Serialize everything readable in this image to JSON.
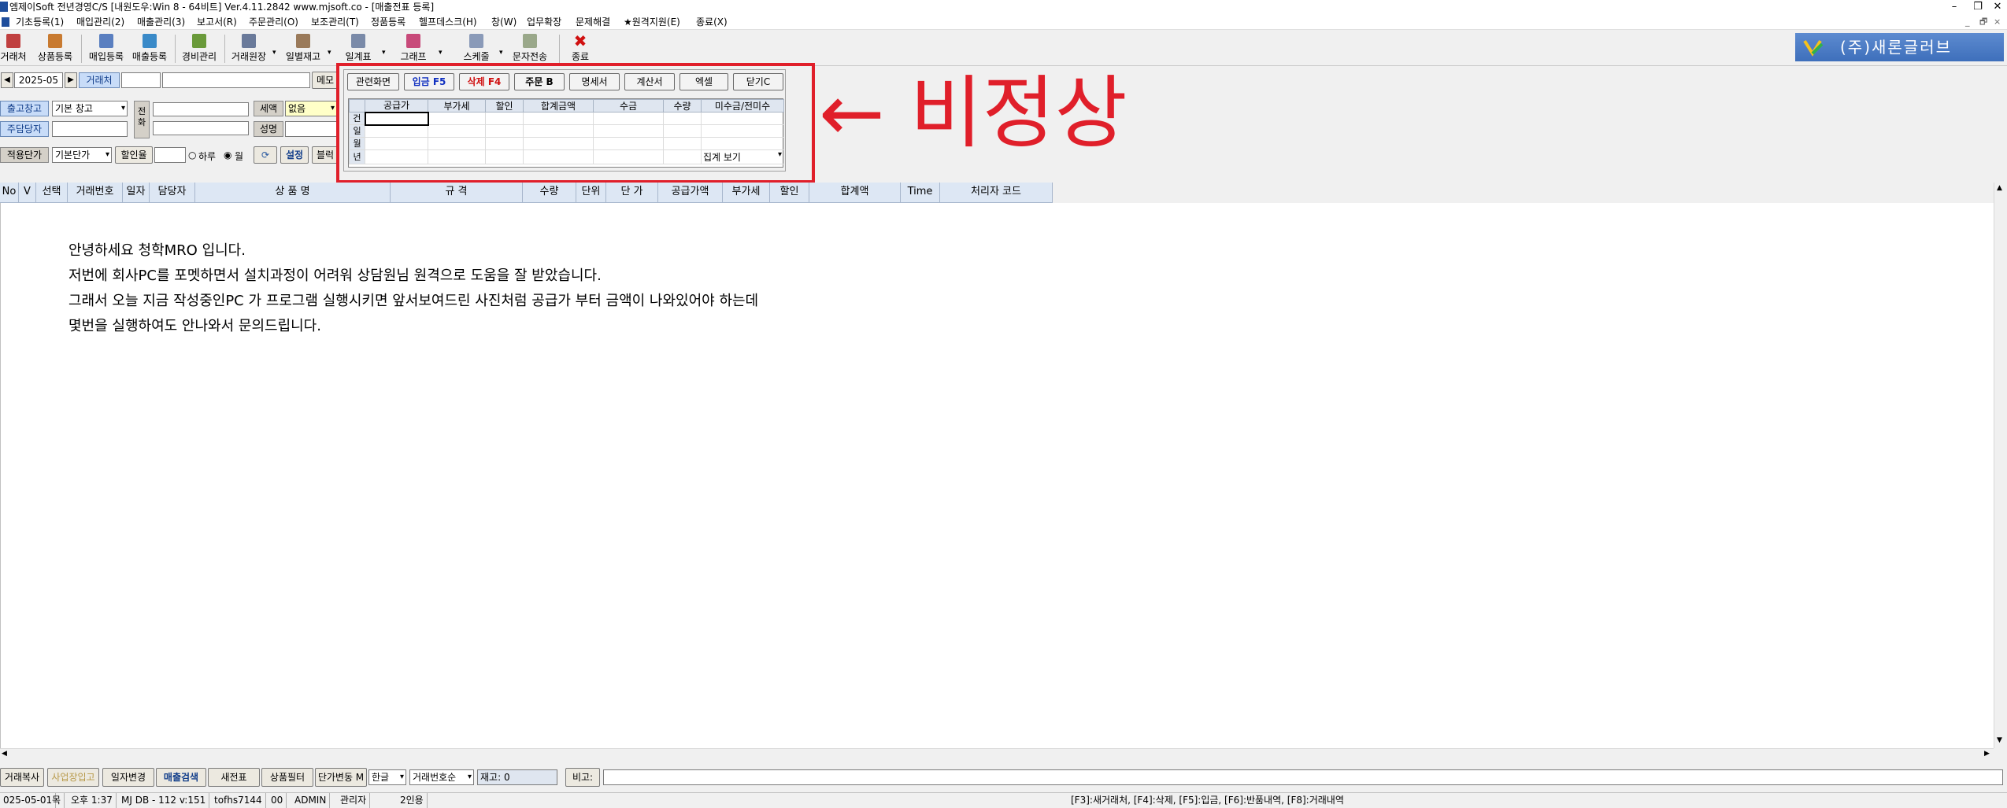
{
  "window": {
    "title": "엠제이Soft 전년경영C/S [내원도우:Win 8 - 64비트] Ver.4.11.2842        www.mjsoft.co - [매출전표 등록]",
    "min": "–",
    "restore": "❐",
    "close": "✕"
  },
  "menu": {
    "items": [
      "기초등록(1)",
      "매입관리(2)",
      "매출관리(3)",
      "보고서(R)",
      "주문관리(O)",
      "보조관리(T)",
      "정품등록",
      "헬프데스크(H)",
      "창(W)",
      "업무확장",
      "문제해결",
      "★원격지원(E)",
      "종료(X)"
    ],
    "sys": [
      "_",
      "🗗",
      "×"
    ]
  },
  "toolbar": {
    "buttons": [
      "거래처",
      "상품등록",
      "매입등록",
      "매출등록",
      "경비관리",
      "거래원장",
      "일별재고",
      "일계표",
      "그래프",
      "스케줄",
      "문자전송",
      "종료"
    ],
    "brand": "(주)새론글러브"
  },
  "form": {
    "date": "2025-05",
    "client_label": "거래처",
    "memo_label": "메모",
    "warehouse_label": "출고창고",
    "warehouse_value": "기본 창고",
    "staff_label": "주담당자",
    "phone_label": "전화",
    "tax_label": "세액",
    "tax_value": "없음",
    "name_label": "성명",
    "price_label": "적용단가",
    "price_value": "기본단가",
    "discount_label": "할인율",
    "radio_day": "하루",
    "radio_month": "월",
    "settings_label": "설정",
    "block_label": "블럭"
  },
  "popup": {
    "buttons": [
      "관련화면",
      "입금 F5",
      "삭제 F4",
      "주문 B",
      "명세서",
      "계산서",
      "엑셀",
      "닫기C"
    ],
    "columns": [
      "공급가",
      "부가세",
      "할인",
      "합계금액",
      "수금",
      "수량",
      "미수금/전미수"
    ],
    "row_labels": [
      "건",
      "일",
      "월",
      "년"
    ],
    "summary_select": "집계 보기"
  },
  "annotation": "← 비정상",
  "grid": {
    "columns": [
      "No",
      "V",
      "선택",
      "거래번호",
      "일자",
      "담당자",
      "상 품 명",
      "규 격",
      "수량",
      "단위",
      "단 가",
      "공급가액",
      "부가세",
      "할인",
      "합계액",
      "Time",
      "처리자 코드"
    ]
  },
  "message": [
    "안녕하세요 청학MRO 입니다.",
    "저번에 회사PC를 포멧하면서 설치과정이 어려워 상담원님 원격으로 도움을 잘 받았습니다.",
    "그래서 오늘 지금 작성중인PC 가  프로그램 실행시키면 앞서보여드린 사진처럼 공급가 부터 금액이 나와있어야 하는데",
    "몇번을 실행하여도 안나와서 문의드립니다."
  ],
  "bottom": {
    "buttons": [
      "거래복사",
      "사업장입고",
      "일자변경",
      "매출검색",
      "새전표",
      "상품필터",
      "단가변동 M"
    ],
    "lang": "한글",
    "sort": "거래번호순",
    "stock": "재고: 0",
    "note_label": "비고:"
  },
  "status": {
    "date": "025-05-01",
    "weekday": "목",
    "time": "오후 1:37",
    "db": "MJ DB - 112 v:151",
    "user_id": "tofhs7144",
    "code": "00",
    "user": "ADMIN",
    "role": "관리자",
    "seats": "2인용",
    "hint": "[F3]:새거래처, [F4]:삭제, [F5]:입금, [F6]:반품내역, [F8]:거래내역"
  },
  "colors": {
    "accent": "#e01f2a",
    "brand": "#4a7bc4"
  }
}
